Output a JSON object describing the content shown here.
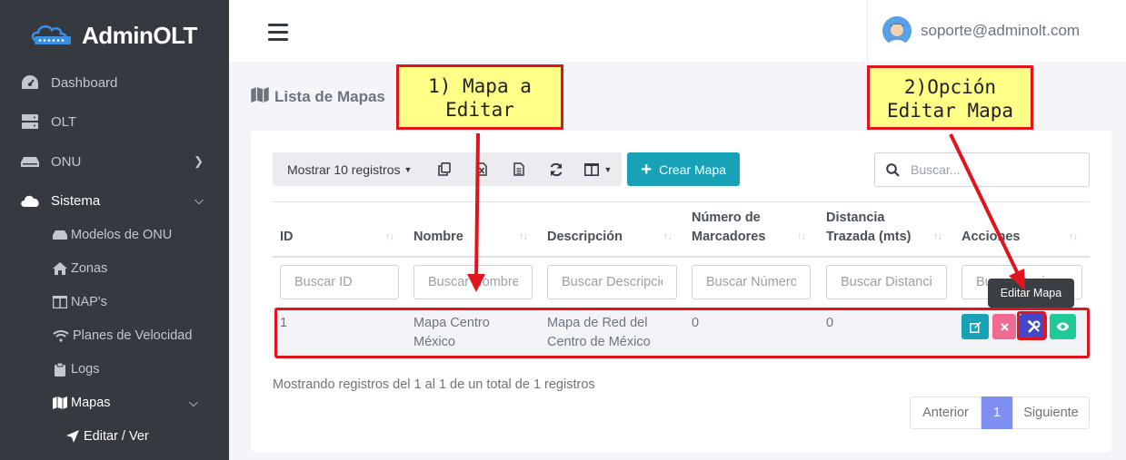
{
  "brand": {
    "name": "AdminOLT"
  },
  "sidebar": {
    "items": [
      {
        "label": "Dashboard",
        "icon": "dashboard-icon"
      },
      {
        "label": "OLT",
        "icon": "server-icon"
      },
      {
        "label": "ONU",
        "icon": "router-icon",
        "has_chevron": true
      },
      {
        "label": "Sistema",
        "icon": "cloud-icon",
        "expanded": true
      }
    ],
    "sub_items": [
      {
        "label": "Modelos de ONU",
        "icon": "hdd-icon"
      },
      {
        "label": "Zonas",
        "icon": "home-icon"
      },
      {
        "label": "NAP's",
        "icon": "columns-icon"
      },
      {
        "label": "Planes de Velocidad",
        "icon": "wifi-icon"
      },
      {
        "label": "Logs",
        "icon": "clipboard-icon"
      },
      {
        "label": "Mapas",
        "icon": "map-icon",
        "expanded": true
      },
      {
        "label": "Editar / Ver",
        "icon": "location-arrow-icon"
      }
    ]
  },
  "header": {
    "user_email": "soporte@adminolt.com"
  },
  "page": {
    "title": "Lista de Mapas"
  },
  "toolbar": {
    "show_records_label": "Mostrar 10 registros",
    "create_label": "Crear Mapa"
  },
  "search": {
    "placeholder": "Buscar..."
  },
  "table": {
    "columns": [
      {
        "line1": "",
        "line2": "ID"
      },
      {
        "line1": "",
        "line2": "Nombre"
      },
      {
        "line1": "",
        "line2": "Descripción"
      },
      {
        "line1": "Número de",
        "line2": "Marcadores"
      },
      {
        "line1": "Distancia",
        "line2": "Trazada (mts)"
      },
      {
        "line1": "",
        "line2": "Acciones"
      }
    ],
    "filter_placeholders": [
      "Buscar ID",
      "Buscar Nombre",
      "Buscar Descripción",
      "Buscar Número",
      "Buscar Distancia",
      "Buscar Acciones"
    ],
    "rows": [
      {
        "id": "1",
        "nombre_line1": "Mapa Centro",
        "nombre_line2": "México",
        "descripcion_line1": "Mapa de Red del",
        "descripcion_line2": "Centro de México",
        "marcadores": "0",
        "distancia": "0"
      }
    ],
    "action_colors": {
      "edit": "#17a2b8",
      "delete": "#f06b8f",
      "edit_map": "#4646c8",
      "view": "#20c997"
    }
  },
  "tooltip": {
    "text": "Editar Mapa"
  },
  "info": {
    "text": "Mostrando registros del 1 al 1 de un total de 1 registros"
  },
  "pagination": {
    "prev": "Anterior",
    "current": "1",
    "next": "Siguiente"
  },
  "annotations": {
    "callout1_line1": "1) Mapa a",
    "callout1_line2": "Editar",
    "callout2_line1": "2)Opción",
    "callout2_line2": "Editar Mapa",
    "color": "#e0141c"
  }
}
